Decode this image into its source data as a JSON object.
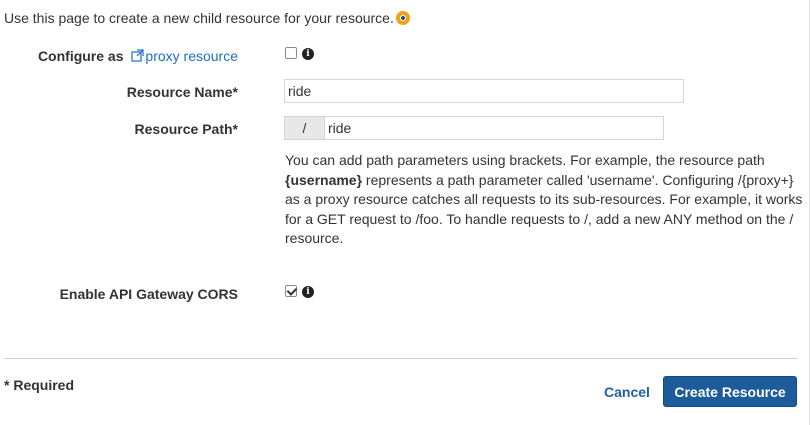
{
  "intro": {
    "text": "Use this page to create a new child resource for your resource.",
    "icon": "resource-target-icon"
  },
  "proxy": {
    "label_prefix": "Configure as",
    "link_text": "proxy resource",
    "checked": false
  },
  "resource_name": {
    "label": "Resource Name*",
    "value": "ride"
  },
  "resource_path": {
    "label": "Resource Path*",
    "prefix": "/",
    "value": "ride"
  },
  "help": {
    "part1": "You can add path parameters using brackets. For example, the resource path ",
    "bold": "{username}",
    "part2": " represents a path parameter called 'username'. Configuring /{proxy+} as a proxy resource catches all requests to its sub-resources. For example, it works for a GET request to /foo. To handle requests to /, add a new ANY method on the / resource."
  },
  "cors": {
    "label": "Enable API Gateway CORS",
    "checked": true
  },
  "footer": {
    "required": "* Required",
    "cancel": "Cancel",
    "create": "Create Resource"
  },
  "colors": {
    "link": "#1f6fc2",
    "primary_button": "#1d5c9b"
  }
}
